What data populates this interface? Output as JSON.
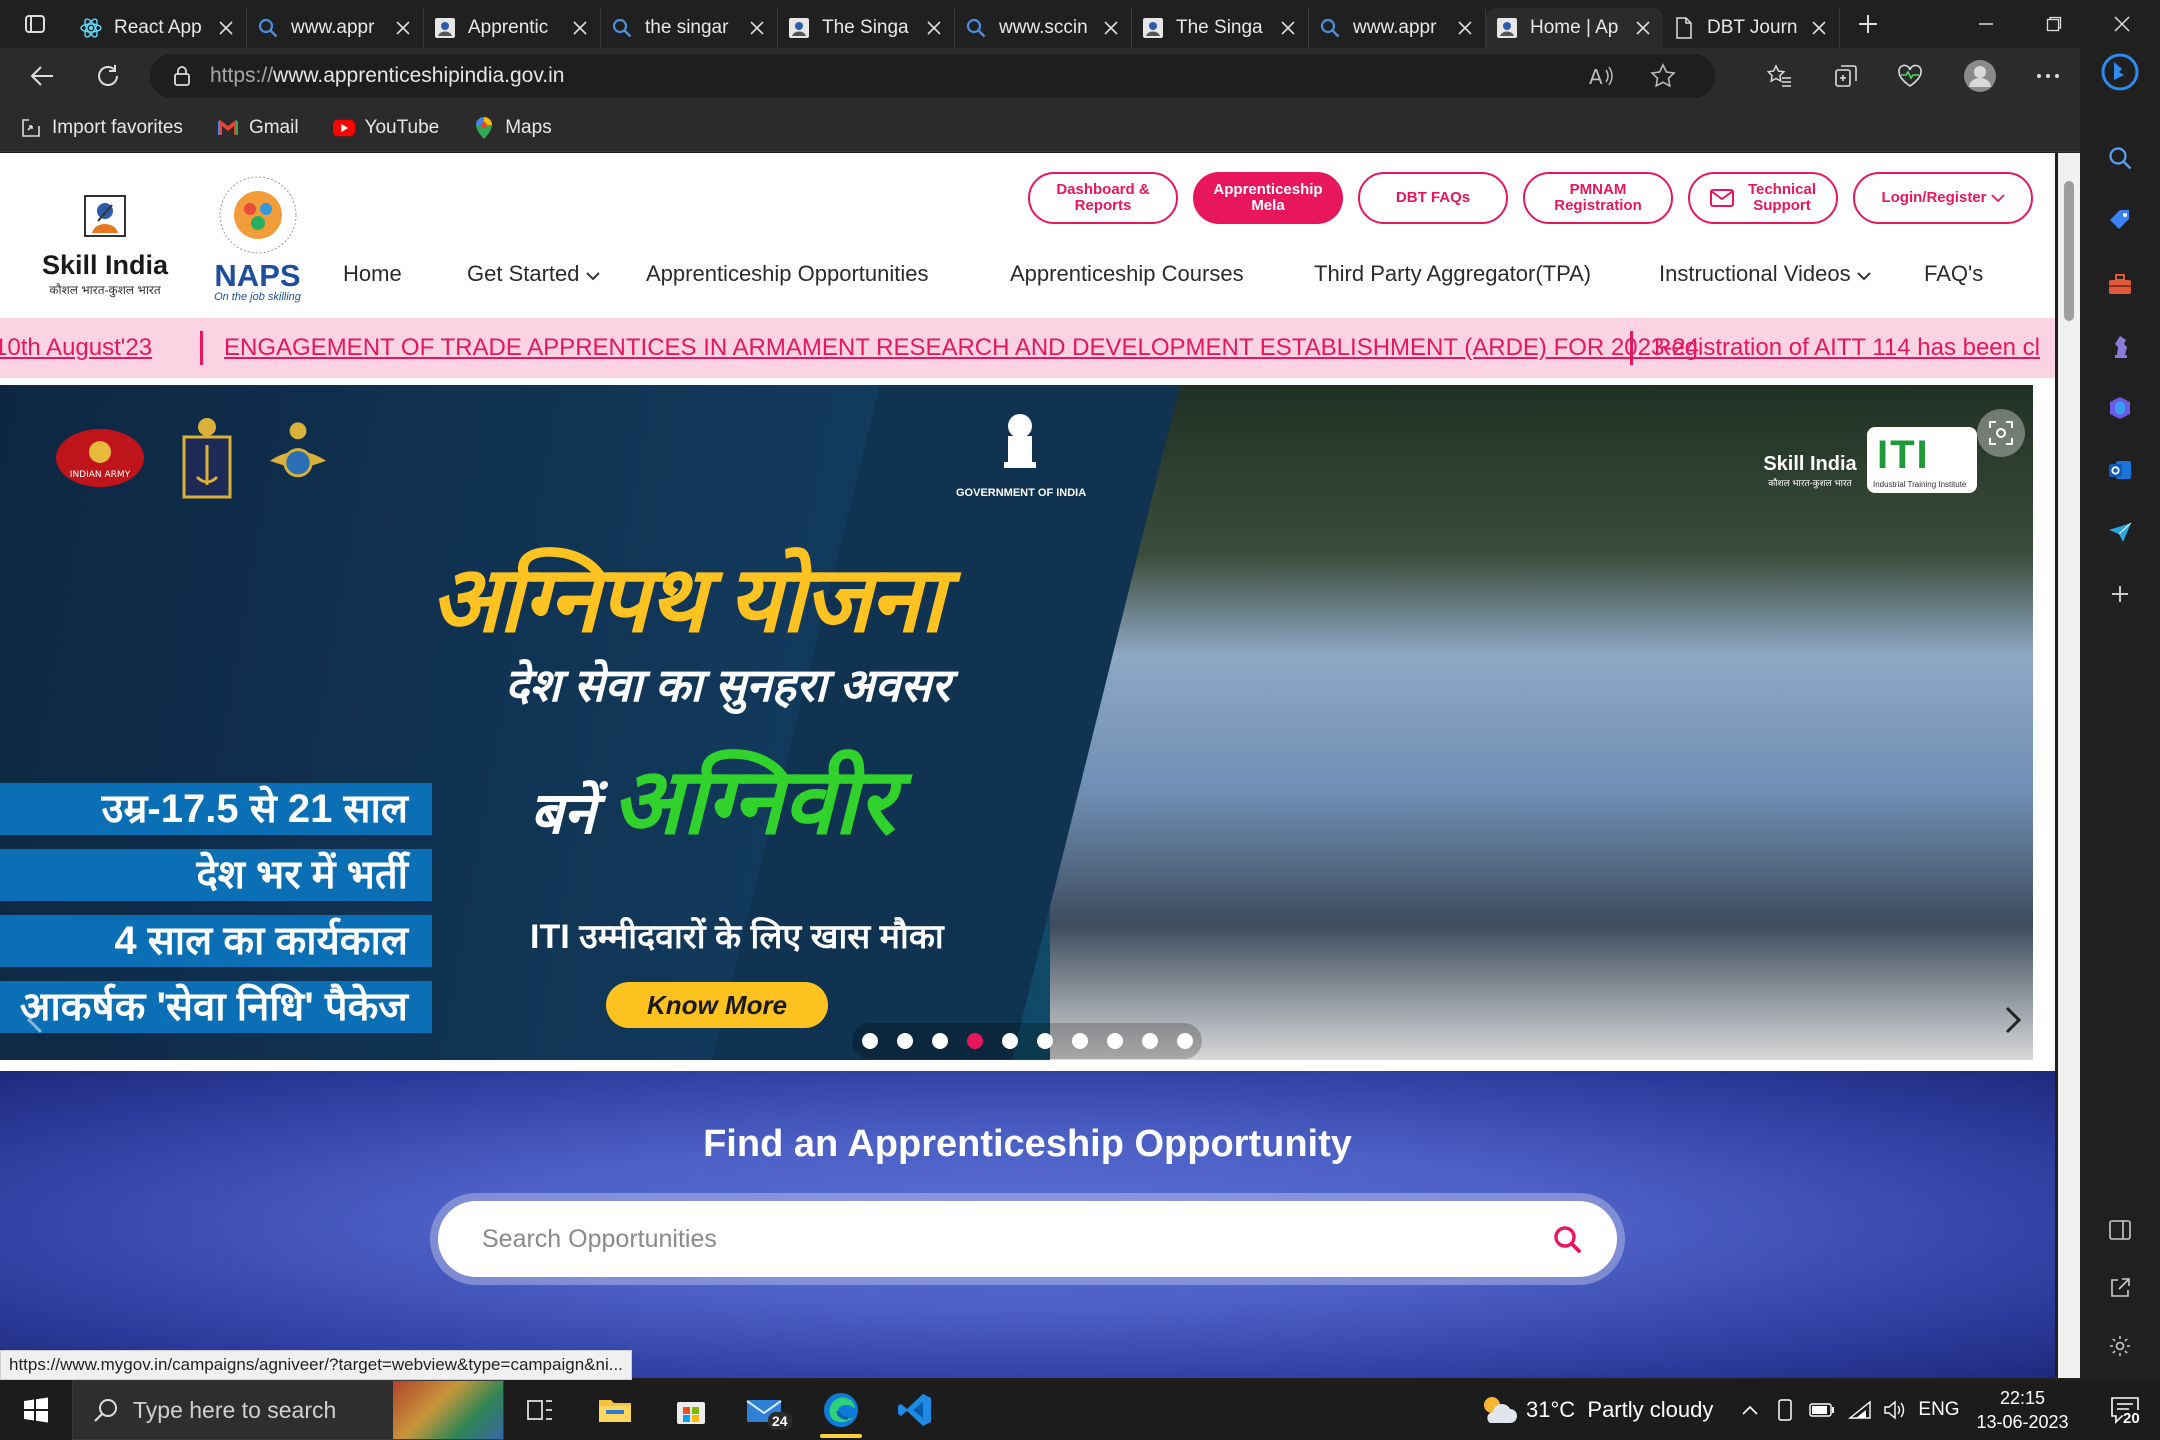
{
  "browser": {
    "tabs": [
      {
        "title": "React App",
        "icon": "react-icon",
        "active": false
      },
      {
        "title": "www.appr",
        "icon": "search-icon",
        "active": false
      },
      {
        "title": "Apprentic",
        "icon": "site-icon",
        "active": false
      },
      {
        "title": "the singar",
        "icon": "search-icon",
        "active": false
      },
      {
        "title": "The Singa",
        "icon": "site-icon",
        "active": false
      },
      {
        "title": "www.sccin",
        "icon": "search-icon",
        "active": false
      },
      {
        "title": "The Singa",
        "icon": "site-icon",
        "active": false
      },
      {
        "title": "www.appr",
        "icon": "search-icon",
        "active": false
      },
      {
        "title": "Home | Ap",
        "icon": "site-icon",
        "active": true
      },
      {
        "title": "DBT Journ",
        "icon": "document-icon",
        "active": false
      }
    ],
    "url_dim": "https://",
    "url_host": "www.apprenticeshipindia.gov.in",
    "favorites": [
      {
        "label": "Import favorites",
        "icon": "import-icon"
      },
      {
        "label": "Gmail",
        "icon": "gmail-icon"
      },
      {
        "label": "YouTube",
        "icon": "youtube-icon"
      },
      {
        "label": "Maps",
        "icon": "maps-icon"
      }
    ],
    "status_url": "https://www.mygov.in/campaigns/agniveer/?target=webview&type=campaign&ni..."
  },
  "site": {
    "skill_name": "Skill India",
    "skill_sub": "कौशल भारत-कुशल भारत",
    "naps_name": "NAPS",
    "naps_tag": "On the job skilling",
    "top_buttons": [
      {
        "label": "Dashboard & Reports",
        "l1": "Dashboard &",
        "l2": "Reports"
      },
      {
        "label": "Apprenticeship Mela",
        "l1": "Apprenticeship",
        "l2": "Mela"
      },
      {
        "label": "DBT FAQs",
        "l1": "DBT FAQs",
        "l2": ""
      },
      {
        "label": "PMNAM Registration",
        "l1": "PMNAM",
        "l2": "Registration"
      },
      {
        "label": "Technical Support",
        "l1": "Technical",
        "l2": "Support"
      },
      {
        "label": "Login/Register",
        "l1": "Login/Register",
        "l2": ""
      }
    ],
    "nav": [
      "Home",
      "Get Started",
      "Apprenticeship Opportunities",
      "Apprenticeship Courses",
      "Third Party Aggregator(TPA)",
      "Instructional Videos",
      "FAQ's"
    ],
    "ticker": [
      "10th August'23",
      "ENGAGEMENT OF TRADE APPRENTICES IN ARMAMENT RESEARCH AND DEVELOPMENT ESTABLISHMENT (ARDE) FOR 2023-24",
      "Registration of AITT 114 has been cl"
    ]
  },
  "hero": {
    "army_label": "INDIAN ARMY",
    "gov_label": "GOVERNMENT OF INDIA",
    "title": "अग्निपथ योजना",
    "subtitle": "देश सेवा का सुनहरा अवसर",
    "bane": "बनें",
    "agniveer": "अग्निवीर",
    "iti_line": "ITI उम्मीदवारों के लिए खास मौका",
    "cta": "Know More",
    "strips": [
      "उम्र-17.5 से 21 साल",
      "देश भर में भर्ती",
      "4 साल का कार्यकाल",
      "आकर्षक 'सेवा निधि' पैकेज"
    ],
    "skill_badge": "Skill India",
    "skill_badge_sub": "कौशल भारत-कुशल भारत",
    "iti_badge": "ITI",
    "iti_badge_sub": "Industrial Training Institute",
    "slides_total": 10,
    "active_slide": 4
  },
  "find": {
    "title": "Find an Apprenticeship Opportunity",
    "placeholder": "Search Opportunities"
  },
  "taskbar": {
    "search_placeholder": "Type here to search",
    "mail_badge": "24",
    "weather_temp": "31°C",
    "weather_desc": "Partly cloudy",
    "lang": "ENG",
    "time": "22:15",
    "date": "13-06-2023",
    "notifications": "20"
  },
  "colors": {
    "accent": "#e8175d",
    "ticker_bg": "#fbd3e2",
    "cta": "#ffc321",
    "agniveer_green": "#31d22b"
  }
}
